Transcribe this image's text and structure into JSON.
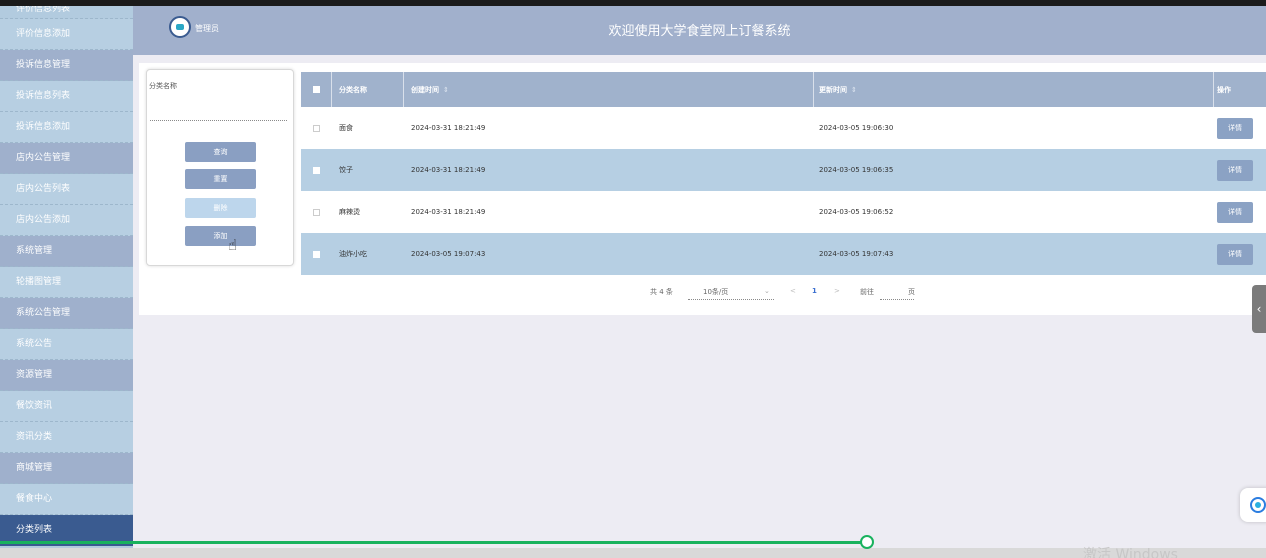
{
  "sidebar": {
    "items": [
      {
        "label": "评价信息列表",
        "type": "partial"
      },
      {
        "label": "评价信息添加",
        "type": "sub"
      },
      {
        "label": "投诉信息管理",
        "type": "group"
      },
      {
        "label": "投诉信息列表",
        "type": "sub"
      },
      {
        "label": "投诉信息添加",
        "type": "sub"
      },
      {
        "label": "店内公告管理",
        "type": "group"
      },
      {
        "label": "店内公告列表",
        "type": "sub"
      },
      {
        "label": "店内公告添加",
        "type": "sub"
      },
      {
        "label": "系统管理",
        "type": "group"
      },
      {
        "label": "轮播图管理",
        "type": "sub"
      },
      {
        "label": "系统公告管理",
        "type": "group"
      },
      {
        "label": "系统公告",
        "type": "sub"
      },
      {
        "label": "资源管理",
        "type": "group"
      },
      {
        "label": "餐饮资讯",
        "type": "sub"
      },
      {
        "label": "资讯分类",
        "type": "sub"
      },
      {
        "label": "商城管理",
        "type": "group"
      },
      {
        "label": "餐食中心",
        "type": "sub"
      },
      {
        "label": "分类列表",
        "type": "active"
      }
    ]
  },
  "header": {
    "user_label": "管理员",
    "title": "欢迎使用大学食堂网上订餐系统",
    "avatar_icon": "robot-avatar-icon"
  },
  "search": {
    "field_label": "分类名称",
    "field_value": "",
    "query_label": "查询",
    "reset_label": "重置",
    "delete_label": "删除",
    "add_label": "添加"
  },
  "table": {
    "headers": {
      "name": "分类名称",
      "created": "创建时间",
      "updated": "更新时间",
      "ops": "操作",
      "sort_icon": "⇕"
    },
    "rows": [
      {
        "name": "面食",
        "created": "2024-03-31 18:21:49",
        "updated": "2024-03-05 19:06:30",
        "action": "详情"
      },
      {
        "name": "饺子",
        "created": "2024-03-31 18:21:49",
        "updated": "2024-03-05 19:06:35",
        "action": "详情"
      },
      {
        "name": "麻辣烫",
        "created": "2024-03-31 18:21:49",
        "updated": "2024-03-05 19:06:52",
        "action": "详情"
      },
      {
        "name": "油炸小吃",
        "created": "2024-03-05 19:07:43",
        "updated": "2024-03-05 19:07:43",
        "action": "详情"
      }
    ]
  },
  "pagination": {
    "total": "共 4 条",
    "page_size": "10条/页",
    "prev": "<",
    "current_page": "1",
    "next": ">",
    "goto_label": "前往",
    "page_suffix": "页"
  },
  "watermark": "激活 Windows",
  "colors": {
    "sidebar": "#b2cbdf",
    "header": "#a1b0cc",
    "active": "#3a5b90",
    "row_alt": "#b6cfe3",
    "progress": "#19b25e"
  }
}
